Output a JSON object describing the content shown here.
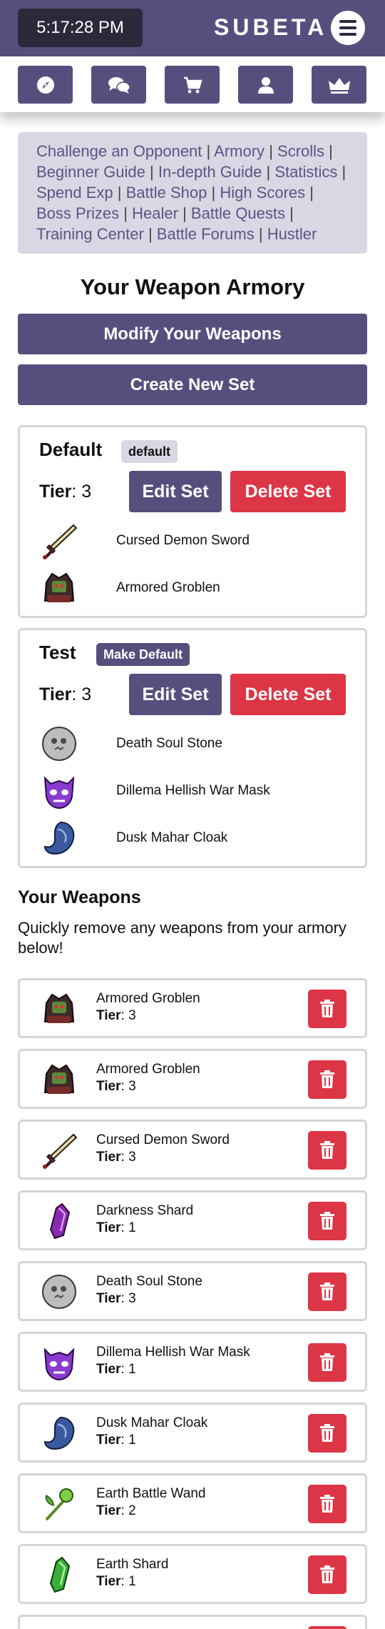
{
  "header": {
    "clock": "5:17:28 PM",
    "brand": "SUBETA",
    "menu_icon": "hamburger-icon",
    "nav": [
      {
        "icon": "compass-icon"
      },
      {
        "icon": "chat-icon"
      },
      {
        "icon": "cart-icon"
      },
      {
        "icon": "user-icon"
      },
      {
        "icon": "crown-icon"
      }
    ]
  },
  "links": [
    "Challenge an Opponent",
    "Armory",
    "Scrolls",
    "Beginner Guide",
    "In-depth Guide",
    "Statistics",
    "Spend Exp",
    "Battle Shop",
    "High Scores",
    "Boss Prizes",
    "Healer",
    "Battle Quests",
    "Training Center",
    "Battle Forums",
    "Hustler"
  ],
  "page_title": "Your Weapon Armory",
  "buttons": {
    "modify": "Modify Your Weapons",
    "create": "Create New Set",
    "edit": "Edit Set",
    "delete": "Delete Set"
  },
  "tier_label": "Tier",
  "sets": [
    {
      "name": "Default",
      "badge": "default",
      "tier": ": 3",
      "items": [
        {
          "name": "Cursed Demon Sword",
          "icon": "sword-icon"
        },
        {
          "name": "Armored Groblen",
          "icon": "armored-groblen-icon"
        }
      ]
    },
    {
      "name": "Test",
      "badge": "Make Default",
      "tier": ": 3",
      "items": [
        {
          "name": "Death Soul Stone",
          "icon": "stone-icon"
        },
        {
          "name": "Dillema Hellish War Mask",
          "icon": "mask-icon"
        },
        {
          "name": "Dusk Mahar Cloak",
          "icon": "cloak-icon"
        }
      ]
    }
  ],
  "weapons_section": {
    "title": "Your Weapons",
    "description": "Quickly remove any weapons from your armory below!"
  },
  "weapons": [
    {
      "name": "Armored Groblen",
      "tier": ": 3",
      "icon": "armored-groblen-icon"
    },
    {
      "name": "Armored Groblen",
      "tier": ": 3",
      "icon": "armored-groblen-icon"
    },
    {
      "name": "Cursed Demon Sword",
      "tier": ": 3",
      "icon": "sword-icon"
    },
    {
      "name": "Darkness Shard",
      "tier": ": 1",
      "icon": "shard-icon"
    },
    {
      "name": "Death Soul Stone",
      "tier": ": 3",
      "icon": "stone-icon"
    },
    {
      "name": "Dillema Hellish War Mask",
      "tier": ": 1",
      "icon": "mask-icon"
    },
    {
      "name": "Dusk Mahar Cloak",
      "tier": ": 1",
      "icon": "cloak-icon"
    },
    {
      "name": "Earth Battle Wand",
      "tier": ": 2",
      "icon": "wand-icon"
    },
    {
      "name": "Earth Shard",
      "tier": ": 1",
      "icon": "green-shard-icon"
    }
  ],
  "colors": {
    "primary": "#564f7e",
    "danger": "#dc3545",
    "link": "#5a5486",
    "panel": "#d9d7e3"
  }
}
